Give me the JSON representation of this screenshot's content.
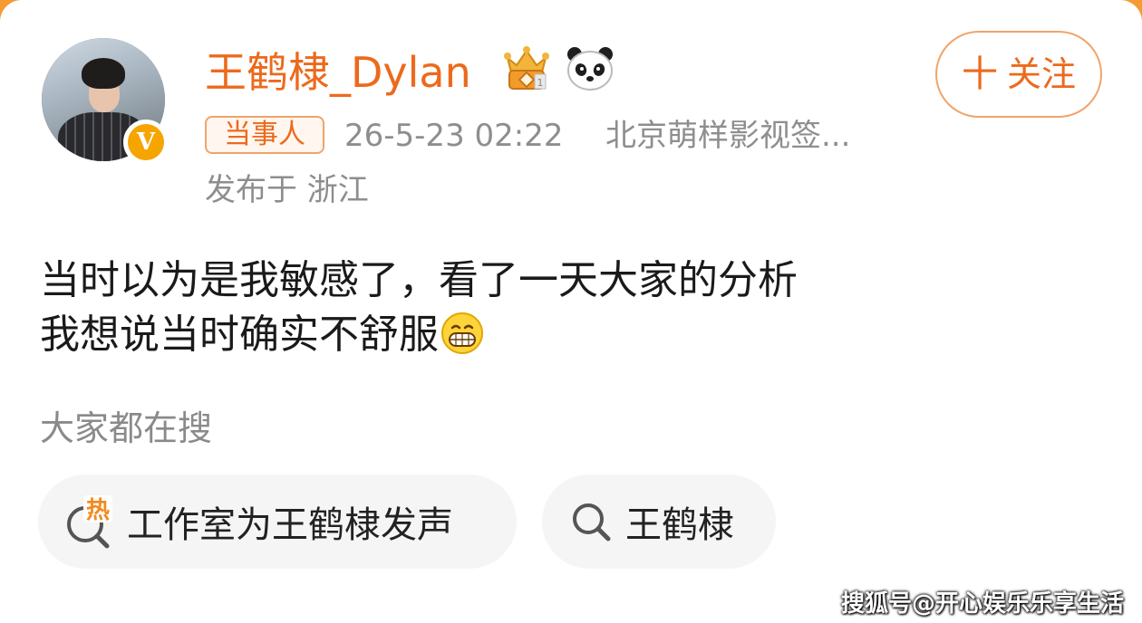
{
  "post": {
    "author": {
      "name": "王鹤棣_Dylan",
      "avatar_icon": "user-avatar",
      "verified_badge": "V",
      "badges": [
        "crown-medal-icon",
        "panda-icon"
      ]
    },
    "follow_button": {
      "icon": "plus-icon",
      "plus": "十",
      "label": "关注"
    },
    "meta": {
      "role_tag": "当事人",
      "timestamp": "26-5-23 02:22",
      "source": "北京萌样影视签...",
      "location": "发布于 浙江"
    },
    "content": {
      "line1": "当时以为是我敏感了，看了一天大家的分析",
      "line2": "我想说当时确实不舒服",
      "emoji": "grinning-face-icon"
    }
  },
  "related_search": {
    "title": "大家都在搜",
    "chips": [
      {
        "icon": "hot-search-icon",
        "hot_mark": "热",
        "label": "工作室为王鹤棣发声"
      },
      {
        "icon": "search-icon",
        "label": "王鹤棣"
      }
    ]
  },
  "watermark": "搜狐号@开心娱乐乐享生活",
  "colors": {
    "accent": "#ec6a1c",
    "meta_gray": "#8e8e8e",
    "chip_bg": "#f5f5f5",
    "badge_gold": "#f6a500"
  }
}
